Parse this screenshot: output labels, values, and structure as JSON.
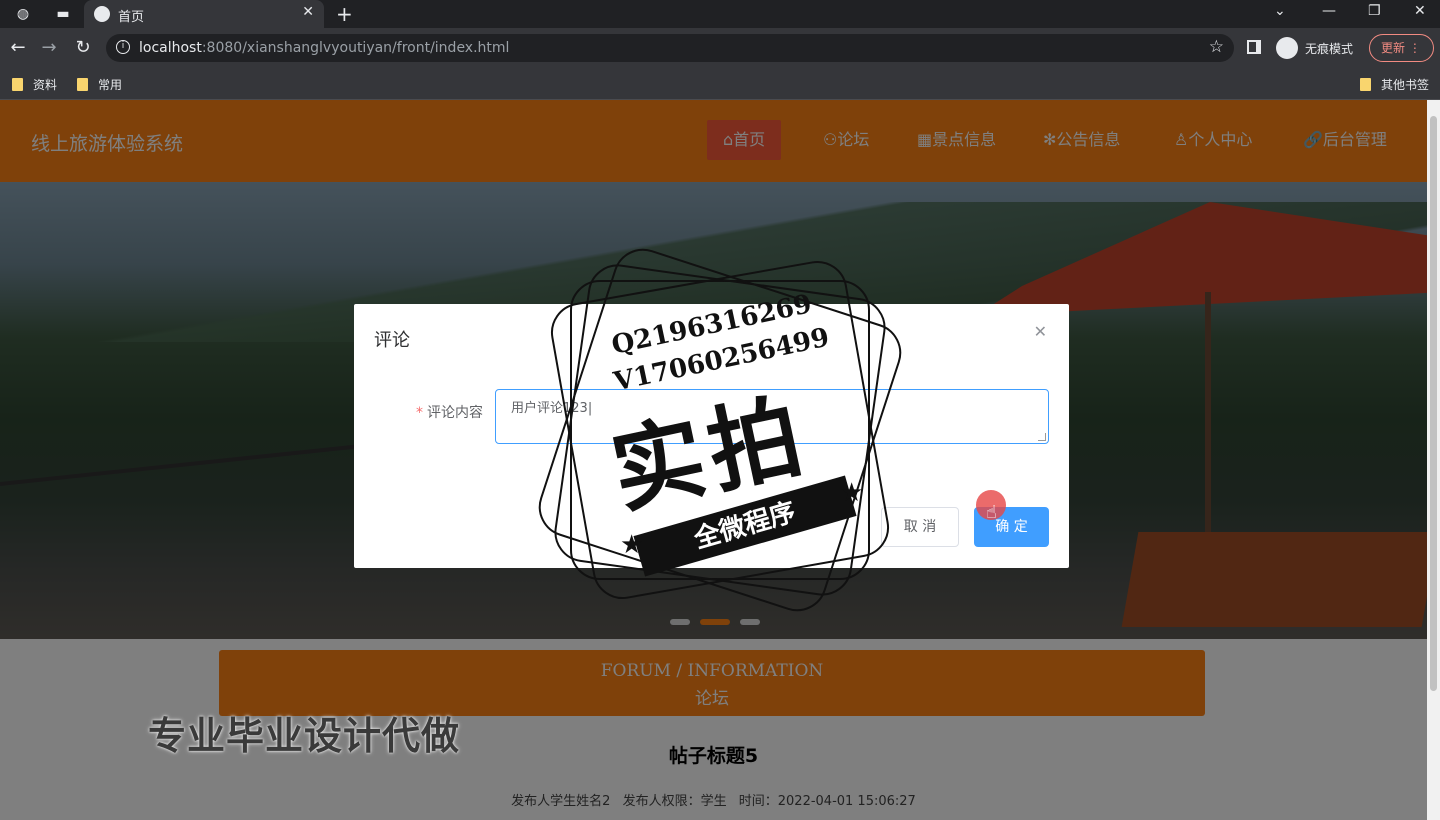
{
  "browser": {
    "tab_title": "首页",
    "url_host": "localhost",
    "url_rest": ":8080/xianshanglvyoutiyan/front/index.html",
    "incognito_label": "无痕模式",
    "update_label": "更新",
    "bookmarks": [
      "资料",
      "常用"
    ],
    "other_bookmarks": "其他书签"
  },
  "site": {
    "title": "线上旅游体验系统",
    "nav": [
      {
        "icon": "⌂",
        "label": "首页"
      },
      {
        "icon": "⚇",
        "label": "论坛"
      },
      {
        "icon": "▦",
        "label": "景点信息"
      },
      {
        "icon": "✻",
        "label": "公告信息"
      },
      {
        "icon": "♙",
        "label": "个人中心"
      },
      {
        "icon": "🔗",
        "label": "后台管理"
      }
    ],
    "active_nav_index": 0
  },
  "forum": {
    "title_en": "FORUM / INFORMATION",
    "title_cn": "论坛"
  },
  "post": {
    "title": "帖子标题5",
    "publisher": "发布人学生姓名2",
    "role": "发布人权限：学生",
    "time": "时间：2022-04-01 15:06:27"
  },
  "dialog": {
    "title": "评论",
    "field_label": "评论内容",
    "field_value": "用户评论123",
    "cancel_label": "取 消",
    "ok_label": "确 定"
  },
  "watermark": {
    "qq": "Q2196316269",
    "wechat": "V17060256499",
    "big": "实拍",
    "banner": "全微程序",
    "side_text": "专业毕业设计代做"
  },
  "colors": {
    "header": "#fe8214",
    "active_nav": "#fb5a3a",
    "primary_button": "#409eff"
  }
}
